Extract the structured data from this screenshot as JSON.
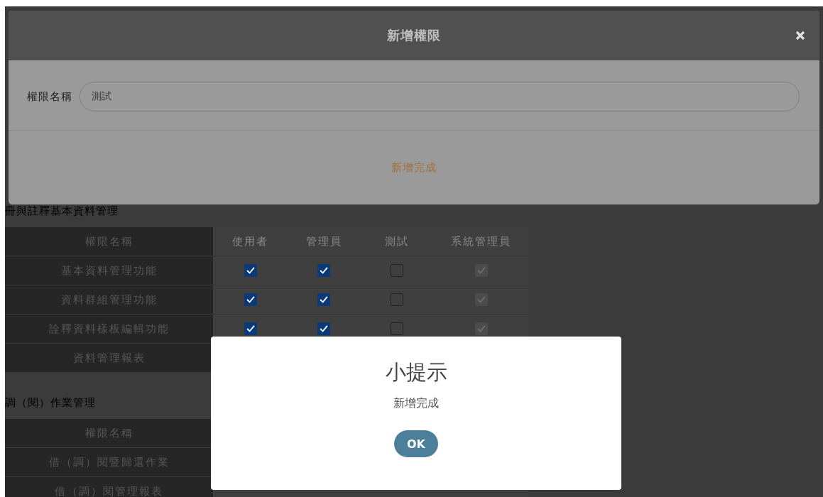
{
  "modal": {
    "title": "新增權限",
    "field": {
      "label": "權限名稱",
      "value": "測試"
    },
    "footer_action": "新增完成"
  },
  "sections": [
    {
      "heading": "冊與註釋基本資料管理",
      "columns": [
        "權限名稱",
        "使用者",
        "管理員",
        "測試",
        "系統管理員"
      ],
      "rows": [
        {
          "name": "基本資料管理功能",
          "checks": [
            {
              "checked": true,
              "disabled": false
            },
            {
              "checked": true,
              "disabled": false
            },
            {
              "checked": false,
              "disabled": false
            },
            {
              "checked": true,
              "disabled": true
            }
          ]
        },
        {
          "name": "資料群組管理功能",
          "checks": [
            {
              "checked": true,
              "disabled": false
            },
            {
              "checked": true,
              "disabled": false
            },
            {
              "checked": false,
              "disabled": false
            },
            {
              "checked": true,
              "disabled": true
            }
          ]
        },
        {
          "name": "詮釋資料樣板編輯功能",
          "checks": [
            {
              "checked": true,
              "disabled": false
            },
            {
              "checked": true,
              "disabled": false
            },
            {
              "checked": false,
              "disabled": false
            },
            {
              "checked": true,
              "disabled": true
            }
          ]
        },
        {
          "name": "資料管理報表"
        }
      ]
    },
    {
      "heading": "調（閱）作業管理",
      "columns": [
        "權限名稱"
      ],
      "rows": [
        {
          "name": "借（調）閱暨歸還作業"
        },
        {
          "name": "借（調）閱管理報表"
        }
      ]
    }
  ],
  "alert": {
    "title": "小提示",
    "message": "新增完成",
    "button": "OK"
  }
}
